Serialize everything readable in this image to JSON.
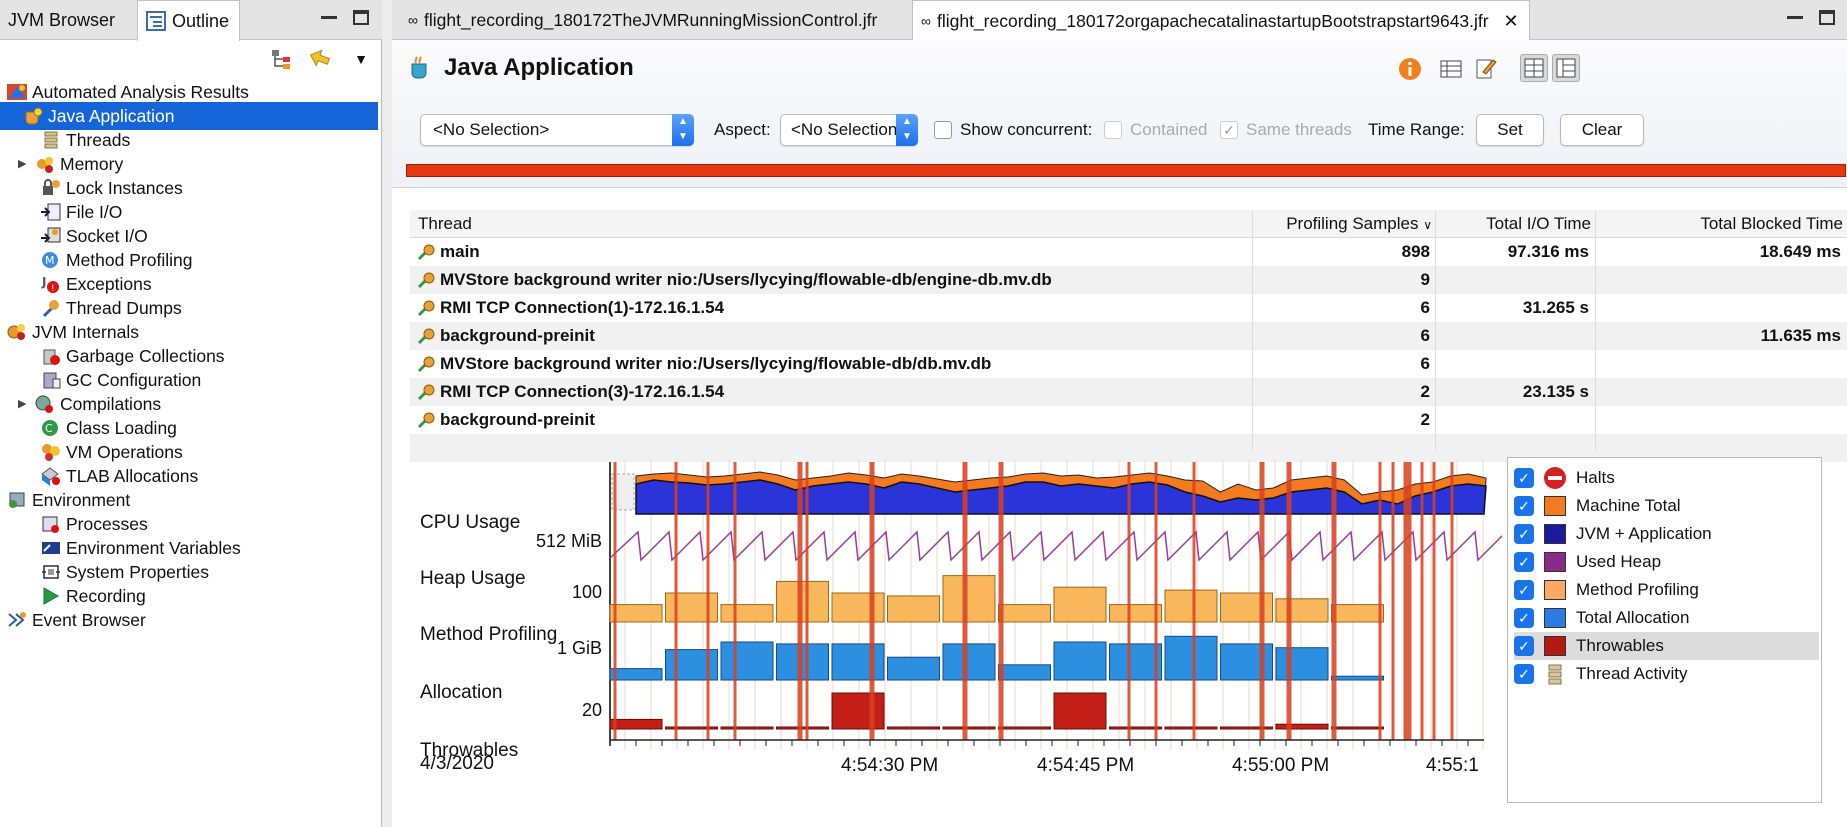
{
  "left": {
    "tabs": [
      {
        "label": "JVM Browser"
      },
      {
        "label": "Outline"
      }
    ],
    "tree": [
      {
        "label": "Automated Analysis Results"
      },
      {
        "label": "Java Application"
      },
      {
        "label": "Threads"
      },
      {
        "label": "Memory"
      },
      {
        "label": "Lock Instances"
      },
      {
        "label": "File I/O"
      },
      {
        "label": "Socket I/O"
      },
      {
        "label": "Method Profiling"
      },
      {
        "label": "Exceptions"
      },
      {
        "label": "Thread Dumps"
      },
      {
        "label": "JVM Internals"
      },
      {
        "label": "Garbage Collections"
      },
      {
        "label": "GC Configuration"
      },
      {
        "label": "Compilations"
      },
      {
        "label": "Class Loading"
      },
      {
        "label": "VM Operations"
      },
      {
        "label": "TLAB Allocations"
      },
      {
        "label": "Environment"
      },
      {
        "label": "Processes"
      },
      {
        "label": "Environment Variables"
      },
      {
        "label": "System Properties"
      },
      {
        "label": "Recording"
      },
      {
        "label": "Event Browser"
      }
    ]
  },
  "editor": {
    "tabs": [
      {
        "label": "flight_recording_180172TheJVMRunningMissionControl.jfr"
      },
      {
        "label": "flight_recording_180172orgapachecatalinastartupBootstrapstart9643.jfr"
      }
    ],
    "title": "Java Application",
    "selection_value": "<No Selection>",
    "aspect_label": "Aspect:",
    "aspect_value": "<No Selection>",
    "show_concurrent_label": "Show concurrent:",
    "contained_label": "Contained",
    "same_threads_label": "Same threads",
    "time_range_label": "Time Range:",
    "set_label": "Set",
    "clear_label": "Clear"
  },
  "table": {
    "headers": [
      "Thread",
      "Profiling Samples",
      "Total I/O Time",
      "Total Blocked Time"
    ],
    "rows": [
      {
        "thread": "main",
        "samples": "898",
        "io": "97.316 ms",
        "blocked": "18.649 ms"
      },
      {
        "thread": "MVStore background writer nio:/Users/lycying/flowable-db/engine-db.mv.db",
        "samples": "9",
        "io": "",
        "blocked": ""
      },
      {
        "thread": "RMI TCP Connection(1)-172.16.1.54",
        "samples": "6",
        "io": "31.265 s",
        "blocked": ""
      },
      {
        "thread": "background-preinit",
        "samples": "6",
        "io": "",
        "blocked": "11.635 ms"
      },
      {
        "thread": "MVStore background writer nio:/Users/lycying/flowable-db/db.mv.db",
        "samples": "6",
        "io": "",
        "blocked": ""
      },
      {
        "thread": "RMI TCP Connection(3)-172.16.1.54",
        "samples": "2",
        "io": "23.135 s",
        "blocked": ""
      },
      {
        "thread": "background-preinit",
        "samples": "2",
        "io": "",
        "blocked": ""
      }
    ]
  },
  "chart": {
    "lanes": [
      "CPU Usage",
      "Heap Usage",
      "Method Profiling",
      "Allocation",
      "Throwables"
    ],
    "yticks": [
      "512 MiB",
      "100",
      "1 GiB",
      "20"
    ],
    "date": "4/3/2020",
    "xticks": [
      "4:54:30 PM",
      "4:54:45 PM",
      "4:55:00 PM",
      "4:55:1"
    ]
  },
  "chart_data": {
    "type": "area",
    "method_profiling": [
      12,
      20,
      12,
      28,
      20,
      18,
      32,
      12,
      24,
      12,
      22,
      20,
      16,
      12
    ],
    "allocation": [
      0.3,
      0.8,
      1.0,
      0.95,
      0.95,
      0.6,
      0.95,
      0.4,
      1.0,
      0.95,
      1.15,
      0.95,
      0.85,
      0.1
    ],
    "throwables": [
      4,
      0,
      0,
      0,
      15,
      0,
      0,
      0,
      15,
      0,
      0,
      0,
      2,
      0
    ]
  },
  "legend": [
    {
      "label": "Halts",
      "color": "#d62020",
      "kind": "halt"
    },
    {
      "label": "Machine Total",
      "color": "#f47a1f"
    },
    {
      "label": "JVM + Application",
      "color": "#1a1a9a"
    },
    {
      "label": "Used Heap",
      "color": "#8a2a8a"
    },
    {
      "label": "Method Profiling",
      "color": "#ffa860"
    },
    {
      "label": "Total Allocation",
      "color": "#2a7de0"
    },
    {
      "label": "Throwables",
      "color": "#b01a10"
    },
    {
      "label": "Thread Activity",
      "color": "#d9c89a",
      "kind": "threads"
    }
  ]
}
